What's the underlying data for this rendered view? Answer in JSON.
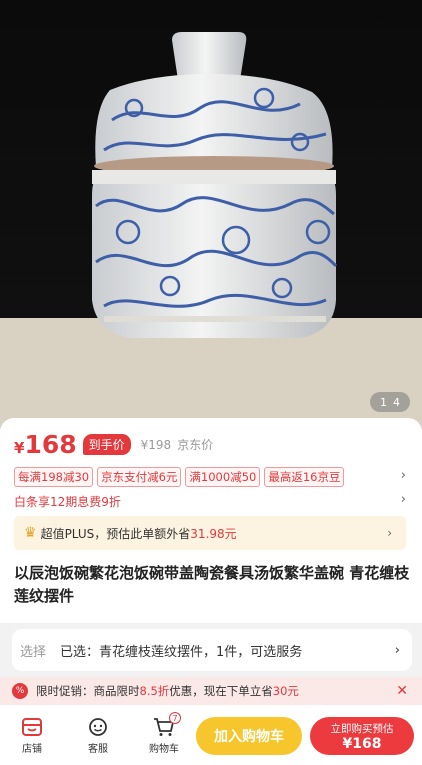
{
  "gallery": {
    "current": "1",
    "total": "4"
  },
  "price": {
    "currency": "¥",
    "value": "168",
    "tag": "到手价",
    "original": "¥198",
    "original_label": "京东价"
  },
  "coupons": [
    "每满198减30",
    "京东支付减6元",
    "满1000减50",
    "最高返16京豆"
  ],
  "baitiao": "白条享12期息费9折",
  "plus": {
    "prefix": "超值PLUS，预估此单额外省",
    "amount": "31.98元"
  },
  "title": "以辰泡饭碗繁花泡饭碗带盖陶瓷餐具汤饭繁华盖碗 青花缠枝莲纹摆件",
  "selection": {
    "label": "选择",
    "value": "已选：青花缠枝莲纹摆件，1件，可选服务"
  },
  "promo": {
    "icon": "%",
    "p1": "限时促销：商品限时",
    "discount": "8.5折",
    "p2": "优惠，现在下单立省",
    "save": "30元"
  },
  "bottom": {
    "store": "店铺",
    "service": "客服",
    "cart": "购物车",
    "cart_count": "7",
    "add_cart": "加入购物车",
    "buy_line1": "立即购买预估",
    "buy_line2": "¥168"
  },
  "colors": {
    "accent": "#e4393c",
    "cart_button": "#f6c62c",
    "buy_button": "#ed3a3f"
  }
}
